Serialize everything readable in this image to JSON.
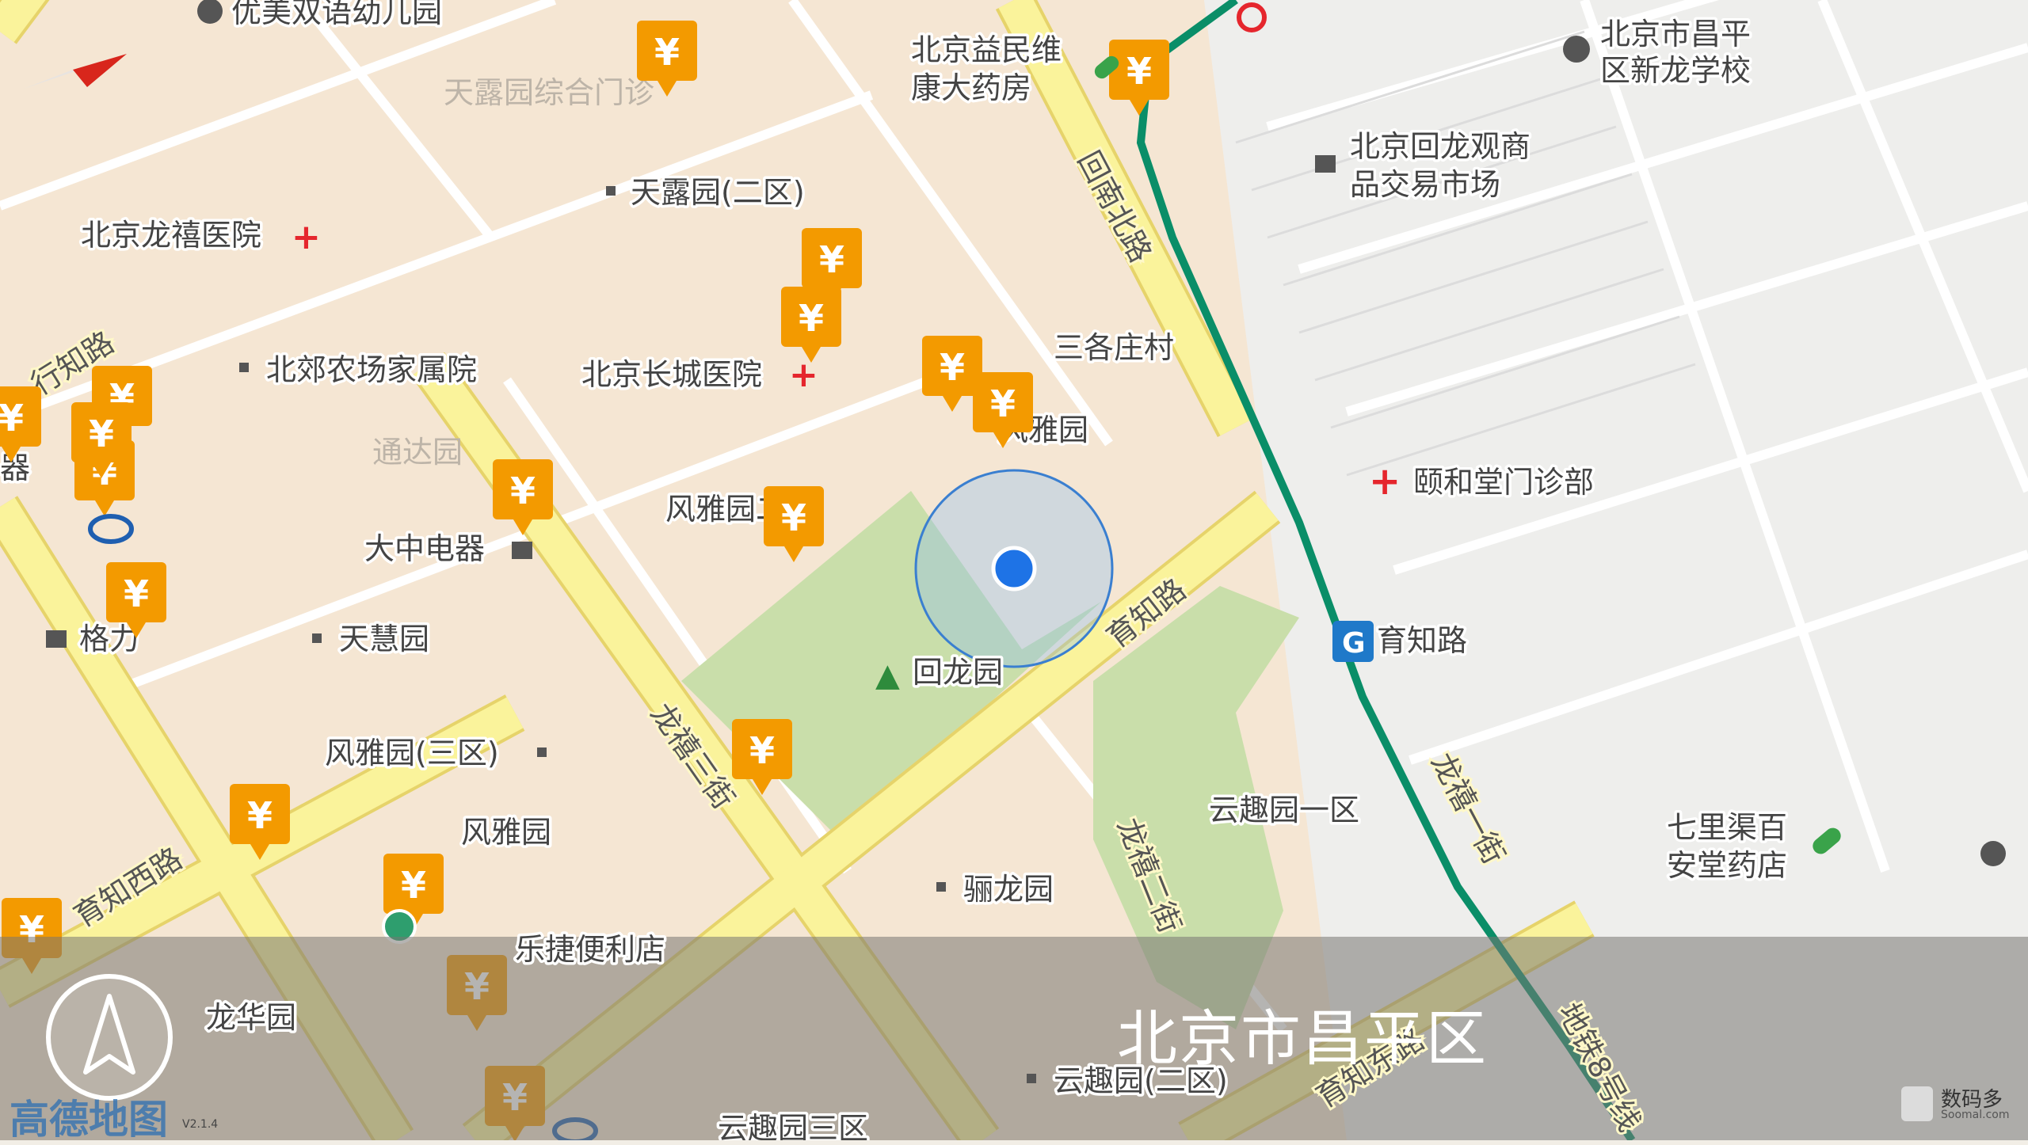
{
  "map": {
    "region_name": "北京市昌平区",
    "logo_text": "高德地图",
    "version": "V2.1.4",
    "watermark": {
      "title": "数码多",
      "subtitle": "Soomal.com"
    },
    "pois": {
      "kindergarten": "优美双语幼儿园",
      "tianluyuan_clinic": "天露园综合门诊",
      "pharmacy_yimin": [
        "北京益民维",
        "康大药房"
      ],
      "school_xinlong": [
        "北京市昌平",
        "区新龙学校"
      ],
      "market_huilongguan": [
        "北京回龙观商",
        "品交易市场"
      ],
      "tianluyuan_2": "天露园(二区)",
      "hospital_longxi": "北京龙禧医院",
      "sangezhuang": "三各庄村",
      "beijiao_farm": "北郊农场家属院",
      "changcheng_hospital": "北京长城医院",
      "fengyayuan_1": "风雅园",
      "yuheitang_clinic": "颐和堂门诊部",
      "tongda": "通达园",
      "fengyayuan_zone": "风雅园二区",
      "dazhong": "大中电器",
      "tianhuiyuan": "天慧园",
      "gree": "格力",
      "huilongyuan": "回龙园",
      "metro_yuzhilu": "育知路",
      "fengyayuan_3": "风雅园(三区)",
      "yunquyuan_1": "云趣园一区",
      "qilique_pharmacy": [
        "七里渠百",
        "安堂药店"
      ],
      "fengyayuan_2": "风雅园",
      "lilongyuan": "骊龙园",
      "lejie_store": "乐捷便利店",
      "longhuayuan": "龙华园",
      "yunquyuan_2": "云趣园(二区)",
      "yunquyuan_3": "云趣园三区",
      "qi": "器"
    },
    "roads": {
      "xingzhi": "行知路",
      "huinanbei": "回南北路",
      "yuzhi": "育知路",
      "longxi_3": "龙禧三街",
      "longxi_2": "龙禧二街",
      "longxi_1": "龙禧一街",
      "yuzhixi": "育知西路",
      "yuzhidong": "育知东路",
      "subway_8": "地铁8号线"
    },
    "atm_symbol": "¥",
    "colors": {
      "atm": "#f39a00",
      "road": "#faf39b",
      "park": "#c9deaa",
      "subway": "#0a8e68",
      "location": "#1e73e6",
      "hospital": "#e5262d"
    }
  }
}
